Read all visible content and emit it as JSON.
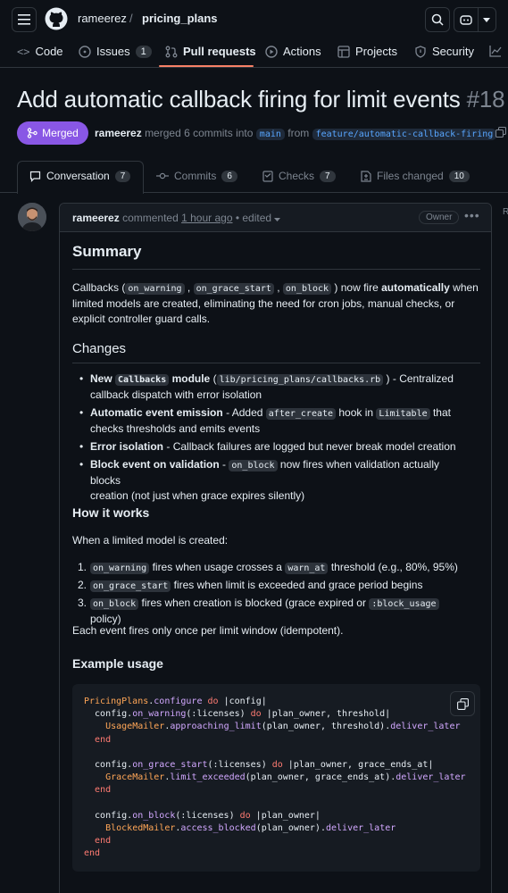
{
  "header": {
    "owner": "rameerez",
    "separator": "/",
    "repo": "pricing_plans"
  },
  "nav": {
    "code": "Code",
    "issues": "Issues",
    "issues_count": "1",
    "pulls": "Pull requests",
    "actions": "Actions",
    "projects": "Projects",
    "security": "Security"
  },
  "pr": {
    "title": "Add automatic callback firing for limit events",
    "number": "#18",
    "status": "Merged",
    "author": "rameerez",
    "merged_text": "merged 6 commits into",
    "base": "main",
    "from": "from",
    "head": "feature/automatic-callback-firing"
  },
  "tabs": {
    "conversation": "Conversation",
    "conversation_count": "7",
    "commits": "Commits",
    "commits_count": "6",
    "checks": "Checks",
    "checks_count": "7",
    "files": "Files changed",
    "files_count": "10"
  },
  "comment": {
    "author": "rameerez",
    "action": "commented",
    "time": "1 hour ago",
    "edited": "• edited",
    "badge": "Owner"
  },
  "content": {
    "summary_h": "Summary",
    "summary_1a": "Callbacks (",
    "summary_code1": "on_warning",
    "summary_code2": "on_grace_start",
    "summary_code3": "on_block",
    "summary_1b": ") now fire",
    "summary_bold": "automatically",
    "summary_1c": "when",
    "summary_2": "limited models are created, eliminating the need for cron jobs, manual checks, or",
    "summary_3": "explicit controller guard calls.",
    "changes_h": "Changes",
    "c1_b1": "New",
    "c1_code": "Callbacks",
    "c1_b2": "module",
    "c1_path": "lib/pricing_plans/callbacks.rb",
    "c1_rest": ") - Centralized",
    "c1_l2": "callback dispatch with error isolation",
    "c2_b": "Automatic event emission",
    "c2_a": "- Added",
    "c2_code1": "after_create",
    "c2_b2": "hook in",
    "c2_code2": "Limitable",
    "c2_c": "that",
    "c2_l2": "checks thresholds and emits events",
    "c3_b": "Error isolation",
    "c3_rest": "- Callback failures are logged but never break model creation",
    "c4_b": "Block event on validation",
    "c4_a": "-",
    "c4_code": "on_block",
    "c4_rest": "now fires when validation actually blocks",
    "c4_l2": "creation (not just when grace expires silently)",
    "how_h": "How it works",
    "how_p": "When a limited model is created:",
    "n1_code": "on_warning",
    "n1_a": "fires when usage crosses a",
    "n1_code2": "warn_at",
    "n1_b": "threshold (e.g., 80%, 95%)",
    "n2_code": "on_grace_start",
    "n2_a": "fires when limit is exceeded and grace period begins",
    "n3_code": "on_block",
    "n3_a": "fires when creation is blocked (grace expired or",
    "n3_code2": ":block_usage",
    "n3_b": "policy)",
    "idem": "Each event fires only once per limit window (idempotent).",
    "example_h": "Example usage"
  },
  "code": [
    "PricingPlans.configure do |config|",
    "  config.on_warning(:licenses) do |plan_owner, threshold|",
    "    UsageMailer.approaching_limit(plan_owner, threshold).deliver_later",
    "  end",
    "",
    "  config.on_grace_start(:licenses) do |plan_owner, grace_ends_at|",
    "    GraceMailer.limit_exceeded(plan_owner, grace_ends_at).deliver_later",
    "  end",
    "",
    "  config.on_block(:licenses) do |plan_owner|",
    "    BlockedMailer.access_blocked(plan_owner).deliver_later",
    "  end",
    "end"
  ],
  "colors": {
    "merged": "#8957e5",
    "accent": "#f78166",
    "link": "#58a6ff"
  }
}
